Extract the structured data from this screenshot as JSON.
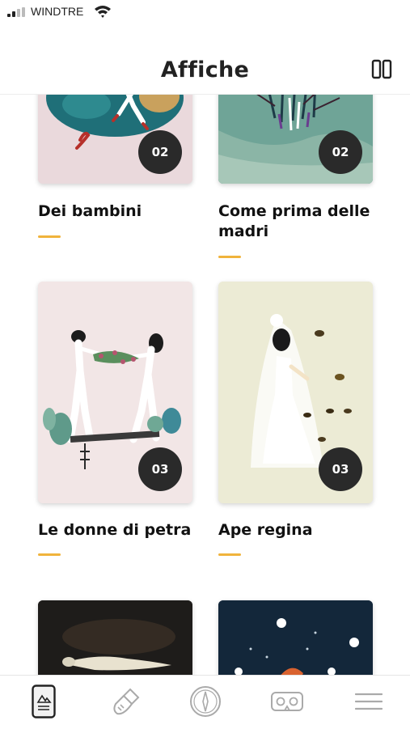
{
  "status_bar": {
    "carrier": "WINDTRE"
  },
  "header": {
    "title": "Affiche"
  },
  "cards": [
    {
      "title": "Dei bambini",
      "badge": "02"
    },
    {
      "title": "Come prima delle madri",
      "badge": "02"
    },
    {
      "title": "Le donne di petra",
      "badge": "03"
    },
    {
      "title": "Ape regina",
      "badge": "03"
    }
  ],
  "tab_bar": {
    "icons": [
      "poster-icon",
      "brush-icon",
      "compass-icon",
      "vr-headset-icon",
      "menu-icon"
    ]
  },
  "colors": {
    "accent": "#f0b33c",
    "badge_bg": "#2a2a2a"
  }
}
